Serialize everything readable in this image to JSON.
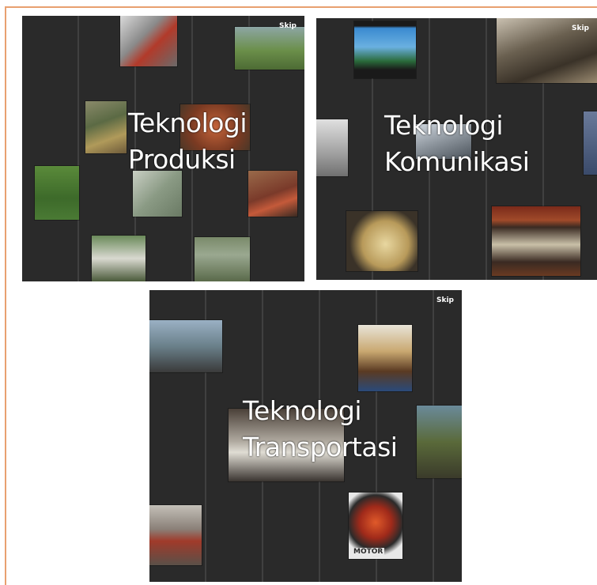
{
  "panels": {
    "produksi": {
      "title_line1": "Teknologi",
      "title_line2": "Produksi",
      "skip": "Skip"
    },
    "komunikasi": {
      "title_line1": "Teknologi",
      "title_line2": "Komunikasi",
      "skip": "Skip"
    },
    "transportasi": {
      "title_line1": "Teknologi",
      "title_line2": "Transportasi",
      "skip": "Skip"
    }
  },
  "labels": {
    "motor": "MOTOR"
  },
  "colors": {
    "panel_bg": "#2a2a2a",
    "frame": "#e8a070"
  },
  "icons": [
    "tractor-photo",
    "rice-field-photo",
    "rice-planter-photo",
    "grain-mill-photo",
    "weaving-photo",
    "harvest-photo",
    "buffalo-plough-photo",
    "fax-machine-photo",
    "television-photo",
    "typewriter-photo",
    "rotary-phone-photo",
    "radio-photo",
    "laptop-photo",
    "helicopter-photo",
    "sailing-ship-photo",
    "car-photo",
    "truck-photo",
    "bicycle-photo",
    "motorcycle-photo"
  ]
}
